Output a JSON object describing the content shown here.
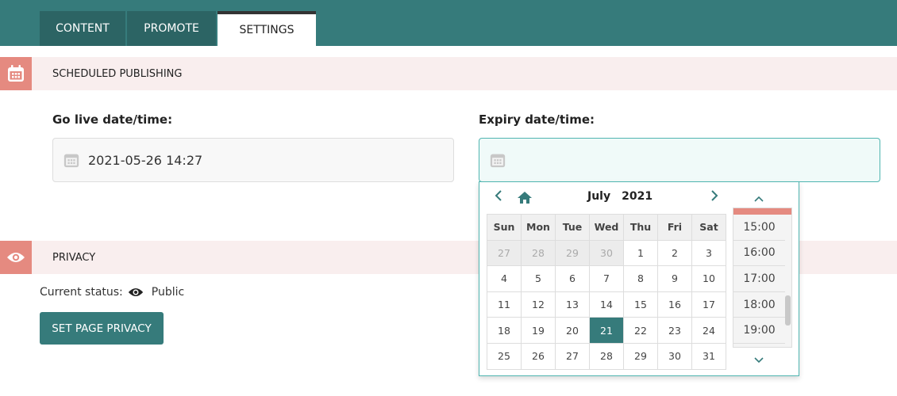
{
  "tabs": [
    {
      "label": "CONTENT"
    },
    {
      "label": "PROMOTE"
    },
    {
      "label": "SETTINGS"
    }
  ],
  "scheduled": {
    "title": "SCHEDULED PUBLISHING",
    "go_live_label": "Go live date/time:",
    "go_live_value": "2021-05-26 14:27",
    "expiry_label": "Expiry date/time:",
    "expiry_value": ""
  },
  "picker": {
    "month": "July",
    "year": "2021",
    "weekdays": [
      "Sun",
      "Mon",
      "Tue",
      "Wed",
      "Thu",
      "Fri",
      "Sat"
    ],
    "weeks": [
      [
        27,
        28,
        29,
        30,
        1,
        2,
        3
      ],
      [
        4,
        5,
        6,
        7,
        8,
        9,
        10
      ],
      [
        11,
        12,
        13,
        14,
        15,
        16,
        17
      ],
      [
        18,
        19,
        20,
        21,
        22,
        23,
        24
      ],
      [
        25,
        26,
        27,
        28,
        29,
        30,
        31
      ]
    ],
    "muted_leading": 4,
    "selected_day": 21,
    "times": [
      "15:00",
      "16:00",
      "17:00",
      "18:00",
      "19:00"
    ]
  },
  "privacy": {
    "title": "PRIVACY",
    "status_label": "Current status:",
    "status_value": "Public",
    "button_label": "SET PAGE PRIVACY"
  },
  "colors": {
    "teal": "#367b7b",
    "salmon": "#e58a80",
    "section_bg": "#f9eeee"
  }
}
